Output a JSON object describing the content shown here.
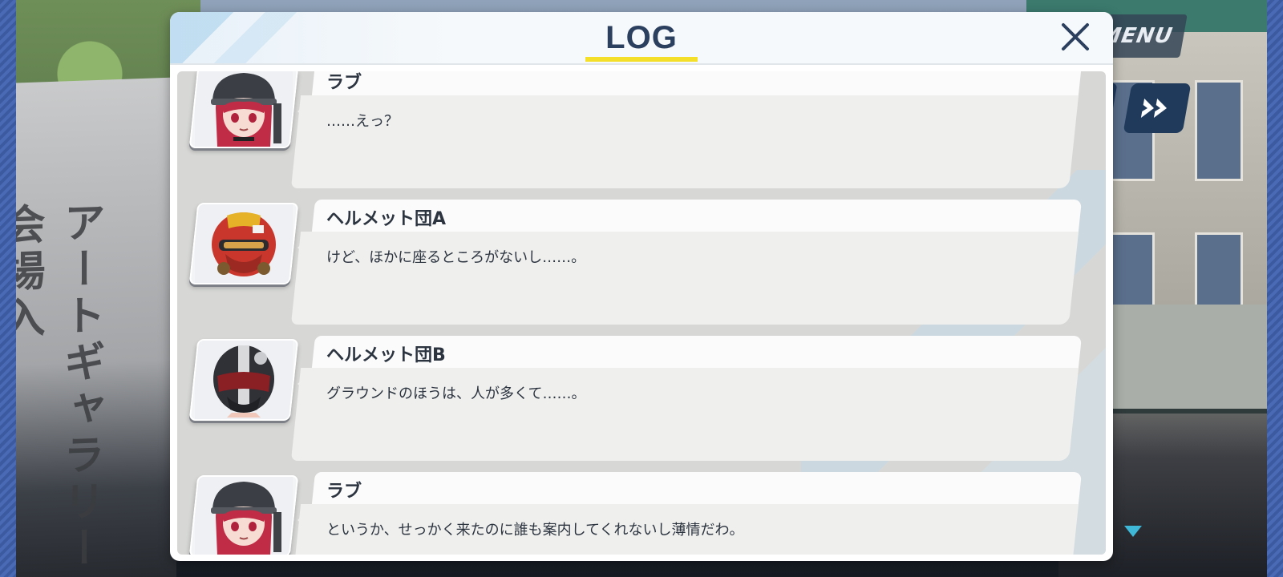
{
  "hud": {
    "menu_label": "MENU",
    "banner_text": "アートギャラリー会場入"
  },
  "modal": {
    "title": "LOG"
  },
  "colors": {
    "title": "#2b3f5e",
    "accent_underline": "#f4df2a",
    "menu_bg": "#344456",
    "fast_forward_bg": "#203a5c"
  },
  "entries": [
    {
      "name": "ラブ",
      "text": "……えっ？",
      "portrait": "love-portrait"
    },
    {
      "name": "ヘルメット団A",
      "text": "けど、ほかに座るところがないし……。",
      "portrait": "helmet-a-portrait"
    },
    {
      "name": "ヘルメット団B",
      "text": "グラウンドのほうは、人が多くて……。",
      "portrait": "helmet-b-portrait"
    },
    {
      "name": "ラブ",
      "text": "というか、せっかく来たのに誰も案内してくれないし薄情だわ。",
      "portrait": "love-portrait"
    }
  ]
}
